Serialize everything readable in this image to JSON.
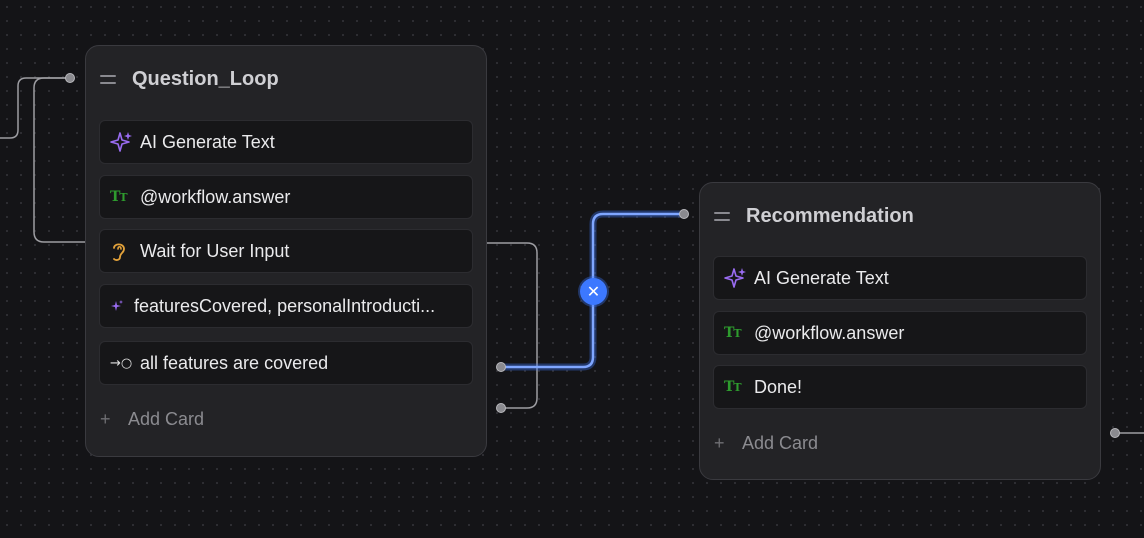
{
  "nodes": {
    "question_loop": {
      "title": "Question_Loop",
      "cards": {
        "ai_generate": "AI Generate Text",
        "workflow_answer": "@workflow.answer",
        "wait_input": "Wait for User Input",
        "variables": "featuresCovered, personalIntroducti...",
        "condition": "all features are covered"
      },
      "add_card": "Add Card"
    },
    "recommendation": {
      "title": "Recommendation",
      "cards": {
        "ai_generate": "AI Generate Text",
        "workflow_answer": "@workflow.answer",
        "done": "Done!"
      },
      "add_card": "Add Card"
    }
  },
  "icons": {
    "drag": "drag-handle-icon",
    "sparkle": "sparkle-icon",
    "text_type": "text-type-icon",
    "ear": "ear-icon",
    "variable_sparkle": "small-sparkle-icon",
    "condition": "arrow-circle-icon",
    "plus": "plus-icon",
    "delete_edge": "close-icon"
  },
  "colors": {
    "sparkle": "#9a6cf2",
    "text_type": "#2e9c2e",
    "ear": "#e3a23a",
    "selected_edge": "#3c78ff",
    "edge": "#a0a0a5"
  }
}
